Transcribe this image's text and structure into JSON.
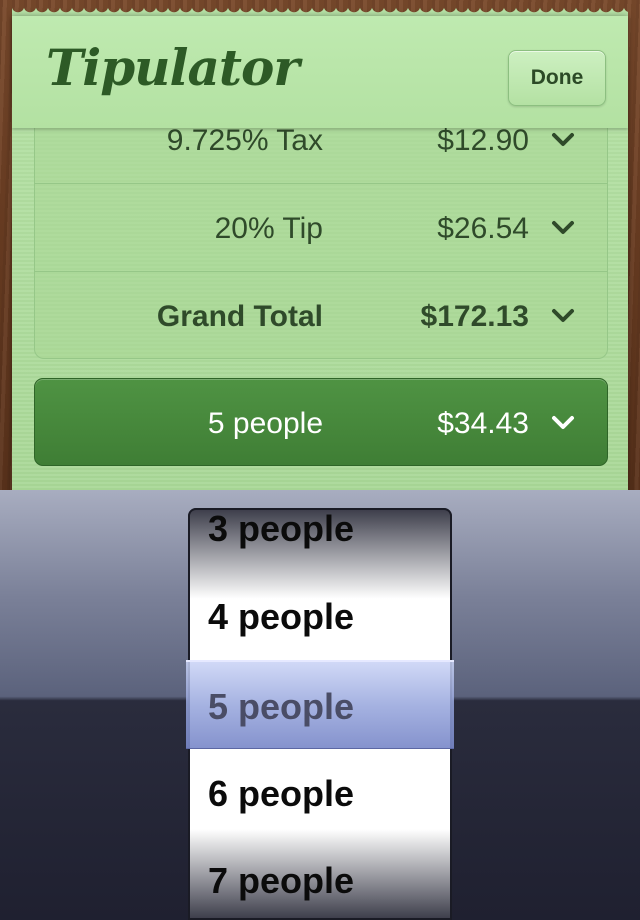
{
  "app": {
    "title": "Tipulator"
  },
  "header": {
    "done_label": "Done"
  },
  "breakdown": [
    {
      "label": "9.725% Tax",
      "value": "$12.90",
      "bold": false
    },
    {
      "label": "20% Tip",
      "value": "$26.54",
      "bold": false
    },
    {
      "label": "Grand Total",
      "value": "$172.13",
      "bold": true
    }
  ],
  "split": {
    "label": "5 people",
    "value": "$34.43"
  },
  "picker": {
    "options": [
      "3 people",
      "4 people",
      "5 people",
      "6 people",
      "7 people"
    ],
    "selected": "5 people"
  },
  "colors": {
    "accent": "#45883a",
    "paper": "#b6e2a6",
    "wood": "#6a3d22"
  }
}
